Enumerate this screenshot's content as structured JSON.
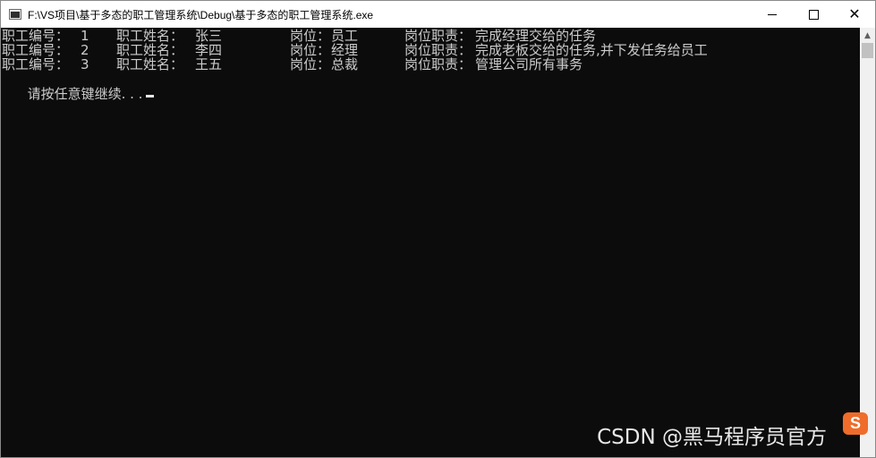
{
  "window": {
    "title": "F:\\VS项目\\基于多态的职工管理系统\\Debug\\基于多态的职工管理系统.exe"
  },
  "console": {
    "rows": [
      {
        "id_label": "职工编号：",
        "id": "1",
        "name_label": "职工姓名：",
        "name": "张三",
        "post_label": "岗位：",
        "post": "员工",
        "duty_label": "岗位职责：",
        "duty": "完成经理交给的任务"
      },
      {
        "id_label": "职工编号：",
        "id": "2",
        "name_label": "职工姓名：",
        "name": "李四",
        "post_label": "岗位：",
        "post": "经理",
        "duty_label": "岗位职责：",
        "duty": "完成老板交给的任务,并下发任务给员工"
      },
      {
        "id_label": "职工编号：",
        "id": "3",
        "name_label": "职工姓名：",
        "name": "王五",
        "post_label": "岗位：",
        "post": "总裁",
        "duty_label": "岗位职责：",
        "duty": "管理公司所有事务"
      }
    ],
    "prompt": "请按任意键继续. . ."
  },
  "watermark": {
    "text": "CSDN @黑马程序员官方",
    "logo_letter": "S"
  },
  "colors": {
    "console_bg": "#0c0c0c",
    "console_text": "#cccccc",
    "titlebar_bg": "#ffffff",
    "logo": "#ef6c2b"
  },
  "icons": {
    "app": "console-app-icon",
    "minimize": "minimize-icon",
    "maximize": "maximize-icon",
    "close": "close-icon",
    "scroll_up": "scroll-up-arrow-icon",
    "ime": "sogou-ime-icon"
  }
}
